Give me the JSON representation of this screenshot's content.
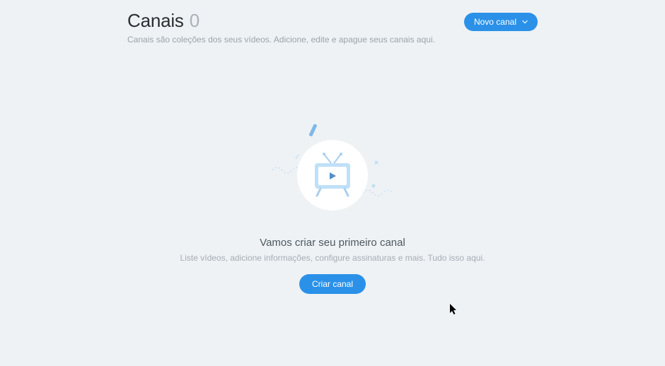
{
  "header": {
    "title": "Canais",
    "count": "0",
    "subtitle": "Canais são coleções dos seus vídeos. Adicione, edite e apague seus canais aqui.",
    "new_button": "Novo canal"
  },
  "empty": {
    "title": "Vamos criar seu primeiro canal",
    "description": "Liste vídeos, adicione informações, configure assinaturas e mais. Tudo isso aqui.",
    "create_button": "Criar canal"
  },
  "icons": {
    "tv": "tv-icon",
    "chevron_down": "chevron-down-icon",
    "cursor": "cursor-icon"
  },
  "colors": {
    "accent": "#2b91e8",
    "bg": "#eef2f5",
    "text_muted": "#9aa3ac"
  }
}
